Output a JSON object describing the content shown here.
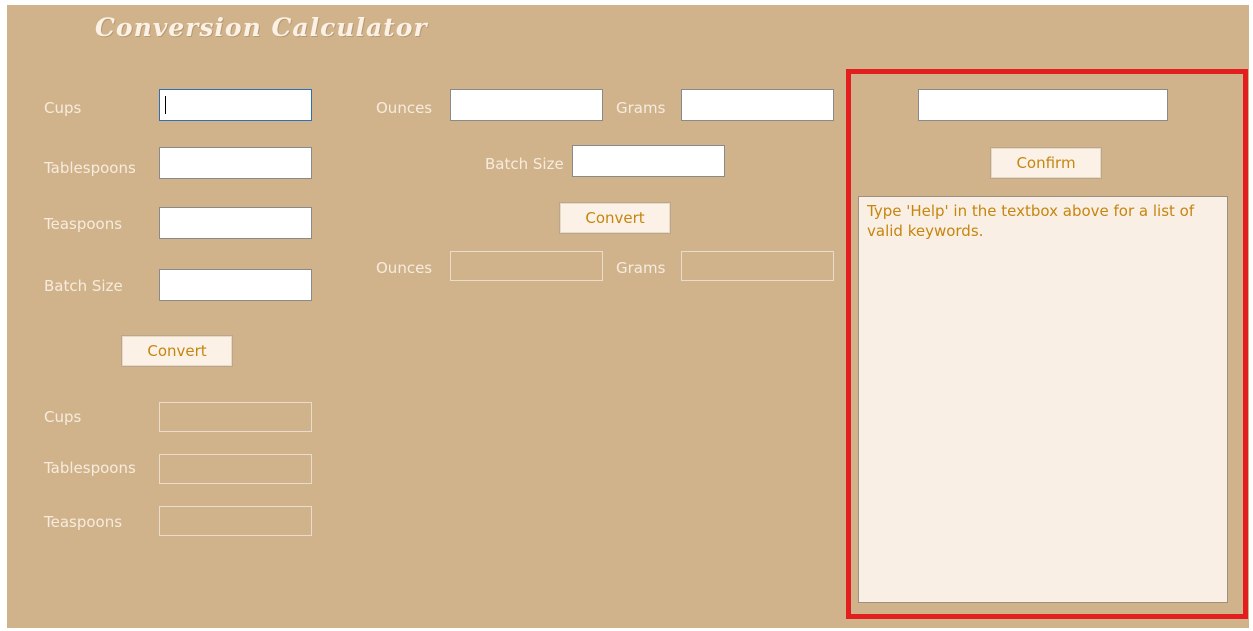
{
  "app": {
    "title": "Conversion Calculator"
  },
  "left": {
    "labels": {
      "cups": "Cups",
      "tablespoons": "Tablespoons",
      "teaspoons": "Teaspoons",
      "batch_size": "Batch Size"
    },
    "inputs": {
      "cups": "",
      "tablespoons": "",
      "teaspoons": "",
      "batch_size": ""
    },
    "convert_label": "Convert",
    "output_labels": {
      "cups": "Cups",
      "tablespoons": "Tablespoons",
      "teaspoons": "Teaspoons"
    },
    "outputs": {
      "cups": "",
      "tablespoons": "",
      "teaspoons": ""
    }
  },
  "middle": {
    "labels": {
      "ounces": "Ounces",
      "grams": "Grams",
      "batch_size": "Batch Size"
    },
    "inputs": {
      "ounces": "",
      "grams": "",
      "batch_size": ""
    },
    "convert_label": "Convert",
    "output_labels": {
      "ounces": "Ounces",
      "grams": "Grams"
    },
    "outputs": {
      "ounces": "",
      "grams": ""
    }
  },
  "right": {
    "keyword_input": "",
    "confirm_label": "Confirm",
    "help_text": "Type 'Help' in the textbox above for a list of valid keywords."
  },
  "colors": {
    "background": "#d1b38b",
    "label_text": "#f7ebdd",
    "button_text": "#c5860f",
    "highlight": "#e31e1e"
  }
}
